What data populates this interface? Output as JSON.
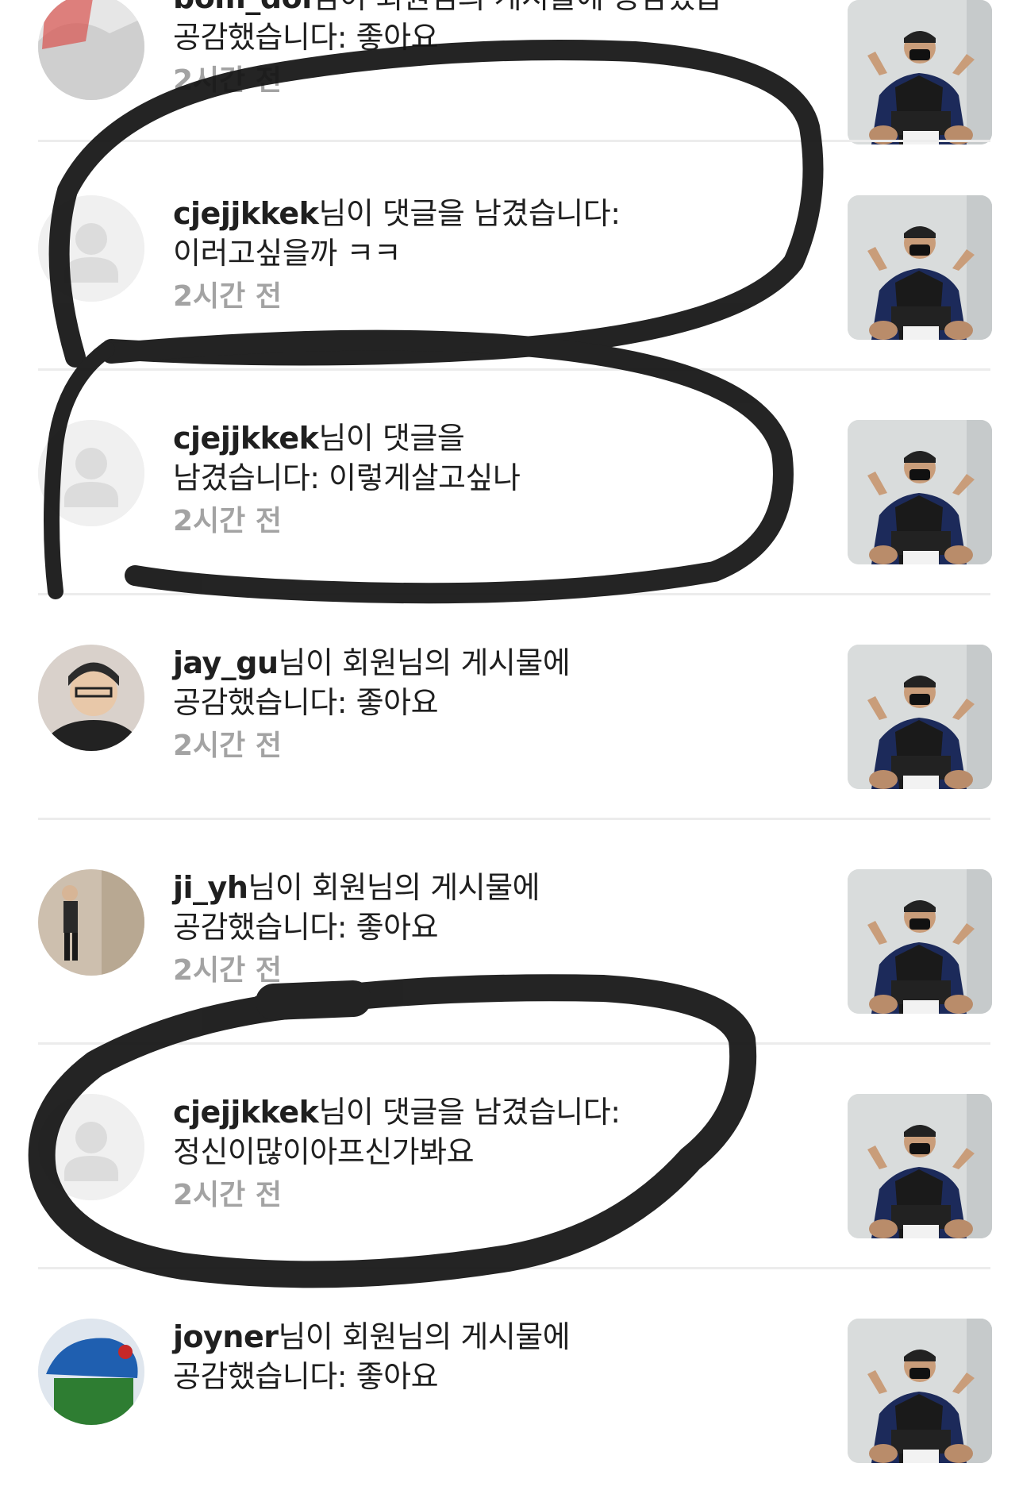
{
  "notifications": [
    {
      "user": "bom_dol",
      "message": "님이 회원님의 게시물에 공감했습니다: 좋아요",
      "line1_rest": "",
      "line2": "공감했습니다: 좋아요",
      "time": "2시간 전"
    },
    {
      "user": "cjejjkkek",
      "message": "님이 댓글을 남겼습니다:",
      "line2": "이러고싶을까 ㅋㅋ",
      "time": "2시간 전"
    },
    {
      "user": "cjejjkkek",
      "message": "님이 댓글을",
      "line2": "남겼습니다: 이렇게살고싶나",
      "time": "2시간 전"
    },
    {
      "user": "jay_gu",
      "message": "님이 회원님의 게시물에",
      "line2": "공감했습니다: 좋아요",
      "time": "2시간 전"
    },
    {
      "user": "ji_yh",
      "message": "님이 회원님의 게시물에",
      "line2": "공감했습니다: 좋아요",
      "time": "2시간 전"
    },
    {
      "user": "cjejjkkek",
      "message": "님이 댓글을 남겼습니다:",
      "line2": "정신이많이아프신가봐요",
      "time": "2시간 전"
    },
    {
      "user": "joyner",
      "message": "님이 회원님의 게시물에",
      "line2": "공감했습니다: 좋아요",
      "time": ""
    }
  ]
}
